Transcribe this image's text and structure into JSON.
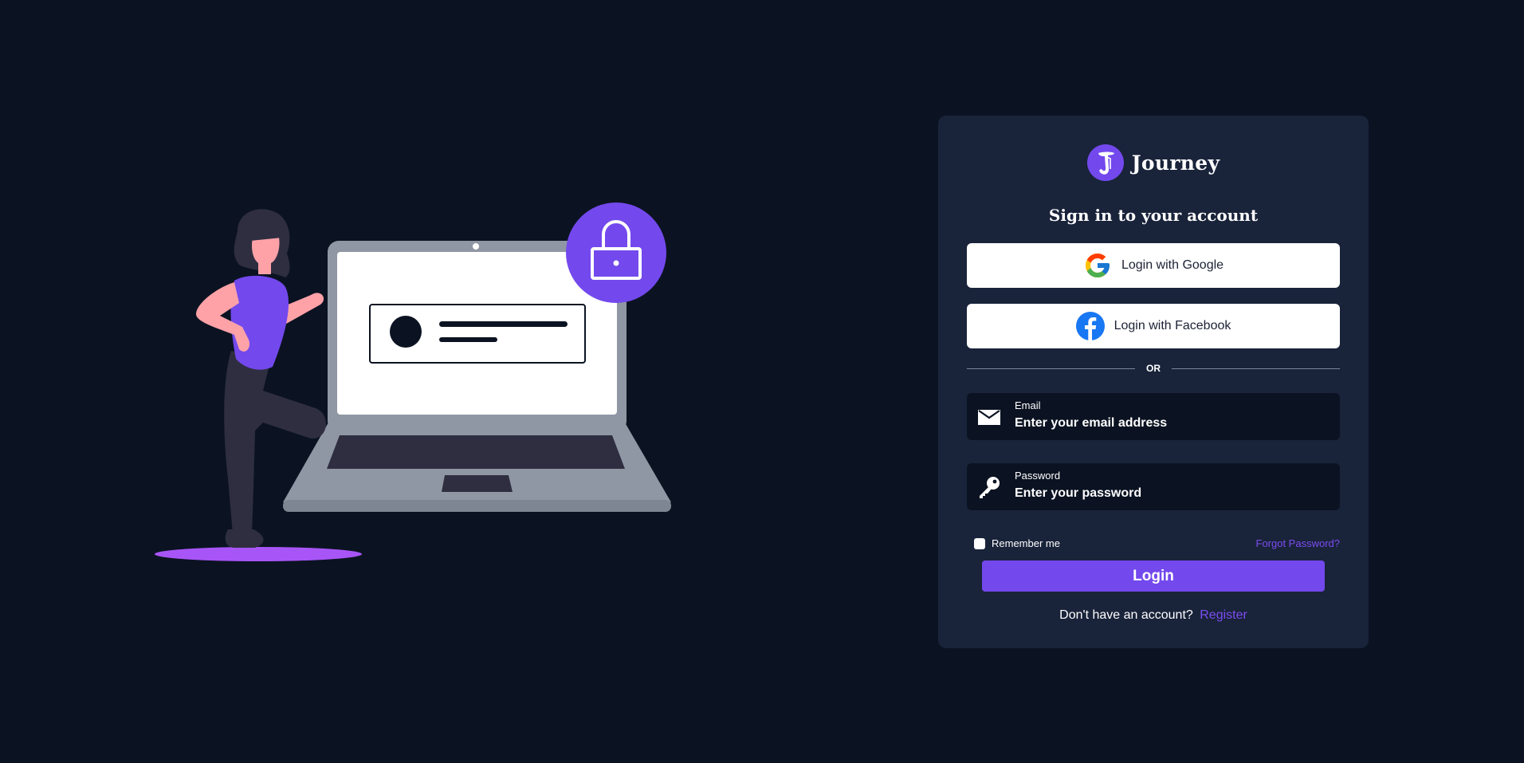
{
  "brand": {
    "name": "Journey",
    "logo_icon": "journey-logo-icon",
    "accent_color": "#7349ed"
  },
  "illustration": {
    "description_icon": "laptop-lock-illustration"
  },
  "card": {
    "heading": "Sign in to your account",
    "google_button": {
      "label": "Login with Google",
      "icon": "google-icon"
    },
    "facebook_button": {
      "label": "Login with Facebook",
      "icon": "facebook-icon"
    },
    "divider_text": "OR",
    "email": {
      "label": "Email",
      "placeholder": "Enter your email address",
      "icon": "mail-icon"
    },
    "password": {
      "label": "Password",
      "placeholder": "Enter your password",
      "icon": "key-icon"
    },
    "remember_label": "Remember me",
    "remember_checked": false,
    "forgot_label": "Forgot Password?",
    "login_label": "Login",
    "register_prompt": "Don't have an account?",
    "register_link": "Register"
  },
  "colors": {
    "page_background": "#0b1322",
    "card_background": "#19233a",
    "link": "#7c4df0"
  }
}
